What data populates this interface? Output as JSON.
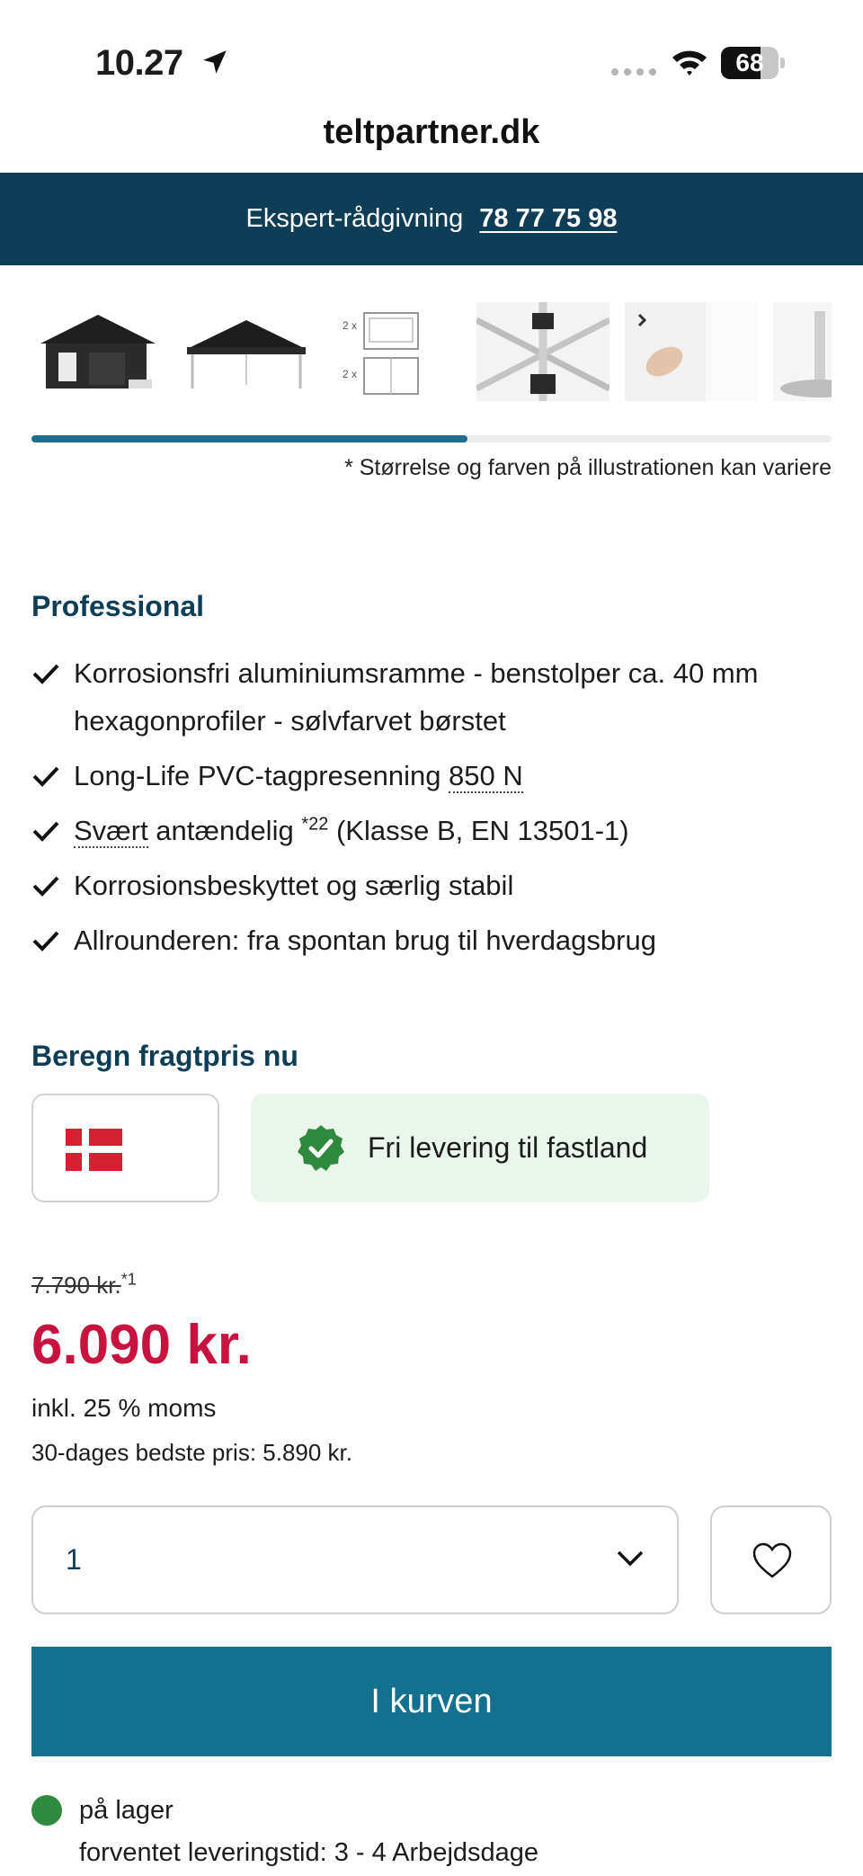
{
  "status_bar": {
    "time": "10.27",
    "battery": "68",
    "battery_level": 0.68
  },
  "browser": {
    "url": "teltpartner.dk"
  },
  "banner": {
    "label": "Ekspert-rådgivning",
    "phone": "78 77 75 98"
  },
  "gallery": {
    "thumbnails": [
      {
        "icon": "black-tent-with-walls-image"
      },
      {
        "icon": "black-canopy-tent-image"
      },
      {
        "icon": "window-sidewall-diagram-image"
      },
      {
        "icon": "aluminium-frame-joint-image"
      },
      {
        "icon": "hand-on-fabric-image"
      },
      {
        "icon": "foot-plate-image"
      }
    ],
    "scroll_progress": 0.545,
    "note": "* Størrelse og farven på illustrationen kan variere"
  },
  "features": {
    "title": "Professional",
    "items": [
      {
        "text": "Korrosionsfri aluminiumsramme - benstolper ca. 40 mm hexagonprofiler - sølvfarvet børstet"
      },
      {
        "prefix": "Long-Life PVC-tagpresenning ",
        "highlight": "850 N"
      },
      {
        "highlight": "Svært",
        "middle": " antændelig ",
        "sup": "*22",
        "suffix": " (Klasse B, EN 13501-1)"
      },
      {
        "text": "Korrosionsbeskyttet og særlig stabil"
      },
      {
        "text": "Allrounderen: fra spontan brug til hverdagsbrug"
      }
    ]
  },
  "shipping": {
    "title": "Beregn fragtpris nu",
    "country_icon": "denmark-flag-icon",
    "delivery_text": "Fri levering til fastland"
  },
  "price": {
    "old": "7.790 kr.",
    "old_sup": "*1",
    "current": "6.090 kr.",
    "vat": "inkl. 25 % moms",
    "best_30_days": "30-dages bedste pris: 5.890 kr."
  },
  "purchase": {
    "quantity": "1",
    "add_to_cart": "I kurven"
  },
  "stock": {
    "status": "på lager",
    "lead_time": "forventet leveringstid: 3 - 4 Arbejdsdage"
  },
  "colors": {
    "navy": "#0e3d57",
    "accent": "#14708f",
    "price_red": "#c8123f",
    "stock_green": "#2f8a3e",
    "delivery_bg": "#eaf5ec"
  }
}
